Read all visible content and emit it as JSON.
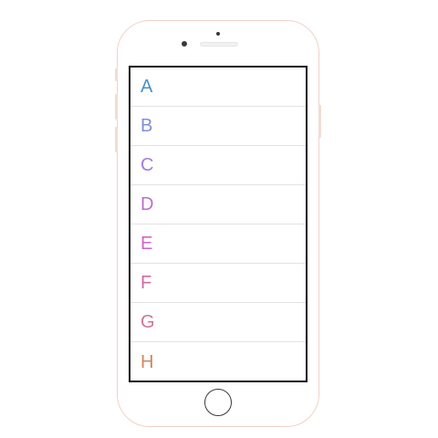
{
  "list": {
    "items": [
      {
        "label": "A",
        "color": "#4a90c8"
      },
      {
        "label": "B",
        "color": "#7f8fd6"
      },
      {
        "label": "C",
        "color": "#a27ed8"
      },
      {
        "label": "D",
        "color": "#c06bd2"
      },
      {
        "label": "E",
        "color": "#d266c4"
      },
      {
        "label": "F",
        "color": "#d469a8"
      },
      {
        "label": "G",
        "color": "#cf7590"
      },
      {
        "label": "H",
        "color": "#d0875f"
      }
    ]
  },
  "device": {
    "frame_color": "#f0d2c8",
    "screen_border_color": "#111111"
  }
}
